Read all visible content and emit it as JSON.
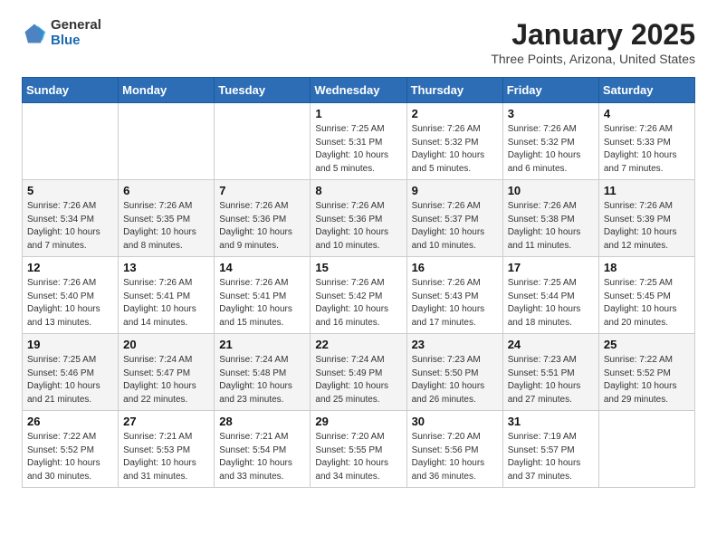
{
  "header": {
    "logo": {
      "general": "General",
      "blue": "Blue"
    },
    "title": "January 2025",
    "location": "Three Points, Arizona, United States"
  },
  "weekdays": [
    "Sunday",
    "Monday",
    "Tuesday",
    "Wednesday",
    "Thursday",
    "Friday",
    "Saturday"
  ],
  "weeks": [
    [
      {
        "day": "",
        "info": ""
      },
      {
        "day": "",
        "info": ""
      },
      {
        "day": "",
        "info": ""
      },
      {
        "day": "1",
        "info": "Sunrise: 7:25 AM\nSunset: 5:31 PM\nDaylight: 10 hours\nand 5 minutes."
      },
      {
        "day": "2",
        "info": "Sunrise: 7:26 AM\nSunset: 5:32 PM\nDaylight: 10 hours\nand 5 minutes."
      },
      {
        "day": "3",
        "info": "Sunrise: 7:26 AM\nSunset: 5:32 PM\nDaylight: 10 hours\nand 6 minutes."
      },
      {
        "day": "4",
        "info": "Sunrise: 7:26 AM\nSunset: 5:33 PM\nDaylight: 10 hours\nand 7 minutes."
      }
    ],
    [
      {
        "day": "5",
        "info": "Sunrise: 7:26 AM\nSunset: 5:34 PM\nDaylight: 10 hours\nand 7 minutes."
      },
      {
        "day": "6",
        "info": "Sunrise: 7:26 AM\nSunset: 5:35 PM\nDaylight: 10 hours\nand 8 minutes."
      },
      {
        "day": "7",
        "info": "Sunrise: 7:26 AM\nSunset: 5:36 PM\nDaylight: 10 hours\nand 9 minutes."
      },
      {
        "day": "8",
        "info": "Sunrise: 7:26 AM\nSunset: 5:36 PM\nDaylight: 10 hours\nand 10 minutes."
      },
      {
        "day": "9",
        "info": "Sunrise: 7:26 AM\nSunset: 5:37 PM\nDaylight: 10 hours\nand 10 minutes."
      },
      {
        "day": "10",
        "info": "Sunrise: 7:26 AM\nSunset: 5:38 PM\nDaylight: 10 hours\nand 11 minutes."
      },
      {
        "day": "11",
        "info": "Sunrise: 7:26 AM\nSunset: 5:39 PM\nDaylight: 10 hours\nand 12 minutes."
      }
    ],
    [
      {
        "day": "12",
        "info": "Sunrise: 7:26 AM\nSunset: 5:40 PM\nDaylight: 10 hours\nand 13 minutes."
      },
      {
        "day": "13",
        "info": "Sunrise: 7:26 AM\nSunset: 5:41 PM\nDaylight: 10 hours\nand 14 minutes."
      },
      {
        "day": "14",
        "info": "Sunrise: 7:26 AM\nSunset: 5:41 PM\nDaylight: 10 hours\nand 15 minutes."
      },
      {
        "day": "15",
        "info": "Sunrise: 7:26 AM\nSunset: 5:42 PM\nDaylight: 10 hours\nand 16 minutes."
      },
      {
        "day": "16",
        "info": "Sunrise: 7:26 AM\nSunset: 5:43 PM\nDaylight: 10 hours\nand 17 minutes."
      },
      {
        "day": "17",
        "info": "Sunrise: 7:25 AM\nSunset: 5:44 PM\nDaylight: 10 hours\nand 18 minutes."
      },
      {
        "day": "18",
        "info": "Sunrise: 7:25 AM\nSunset: 5:45 PM\nDaylight: 10 hours\nand 20 minutes."
      }
    ],
    [
      {
        "day": "19",
        "info": "Sunrise: 7:25 AM\nSunset: 5:46 PM\nDaylight: 10 hours\nand 21 minutes."
      },
      {
        "day": "20",
        "info": "Sunrise: 7:24 AM\nSunset: 5:47 PM\nDaylight: 10 hours\nand 22 minutes."
      },
      {
        "day": "21",
        "info": "Sunrise: 7:24 AM\nSunset: 5:48 PM\nDaylight: 10 hours\nand 23 minutes."
      },
      {
        "day": "22",
        "info": "Sunrise: 7:24 AM\nSunset: 5:49 PM\nDaylight: 10 hours\nand 25 minutes."
      },
      {
        "day": "23",
        "info": "Sunrise: 7:23 AM\nSunset: 5:50 PM\nDaylight: 10 hours\nand 26 minutes."
      },
      {
        "day": "24",
        "info": "Sunrise: 7:23 AM\nSunset: 5:51 PM\nDaylight: 10 hours\nand 27 minutes."
      },
      {
        "day": "25",
        "info": "Sunrise: 7:22 AM\nSunset: 5:52 PM\nDaylight: 10 hours\nand 29 minutes."
      }
    ],
    [
      {
        "day": "26",
        "info": "Sunrise: 7:22 AM\nSunset: 5:52 PM\nDaylight: 10 hours\nand 30 minutes."
      },
      {
        "day": "27",
        "info": "Sunrise: 7:21 AM\nSunset: 5:53 PM\nDaylight: 10 hours\nand 31 minutes."
      },
      {
        "day": "28",
        "info": "Sunrise: 7:21 AM\nSunset: 5:54 PM\nDaylight: 10 hours\nand 33 minutes."
      },
      {
        "day": "29",
        "info": "Sunrise: 7:20 AM\nSunset: 5:55 PM\nDaylight: 10 hours\nand 34 minutes."
      },
      {
        "day": "30",
        "info": "Sunrise: 7:20 AM\nSunset: 5:56 PM\nDaylight: 10 hours\nand 36 minutes."
      },
      {
        "day": "31",
        "info": "Sunrise: 7:19 AM\nSunset: 5:57 PM\nDaylight: 10 hours\nand 37 minutes."
      },
      {
        "day": "",
        "info": ""
      }
    ]
  ]
}
